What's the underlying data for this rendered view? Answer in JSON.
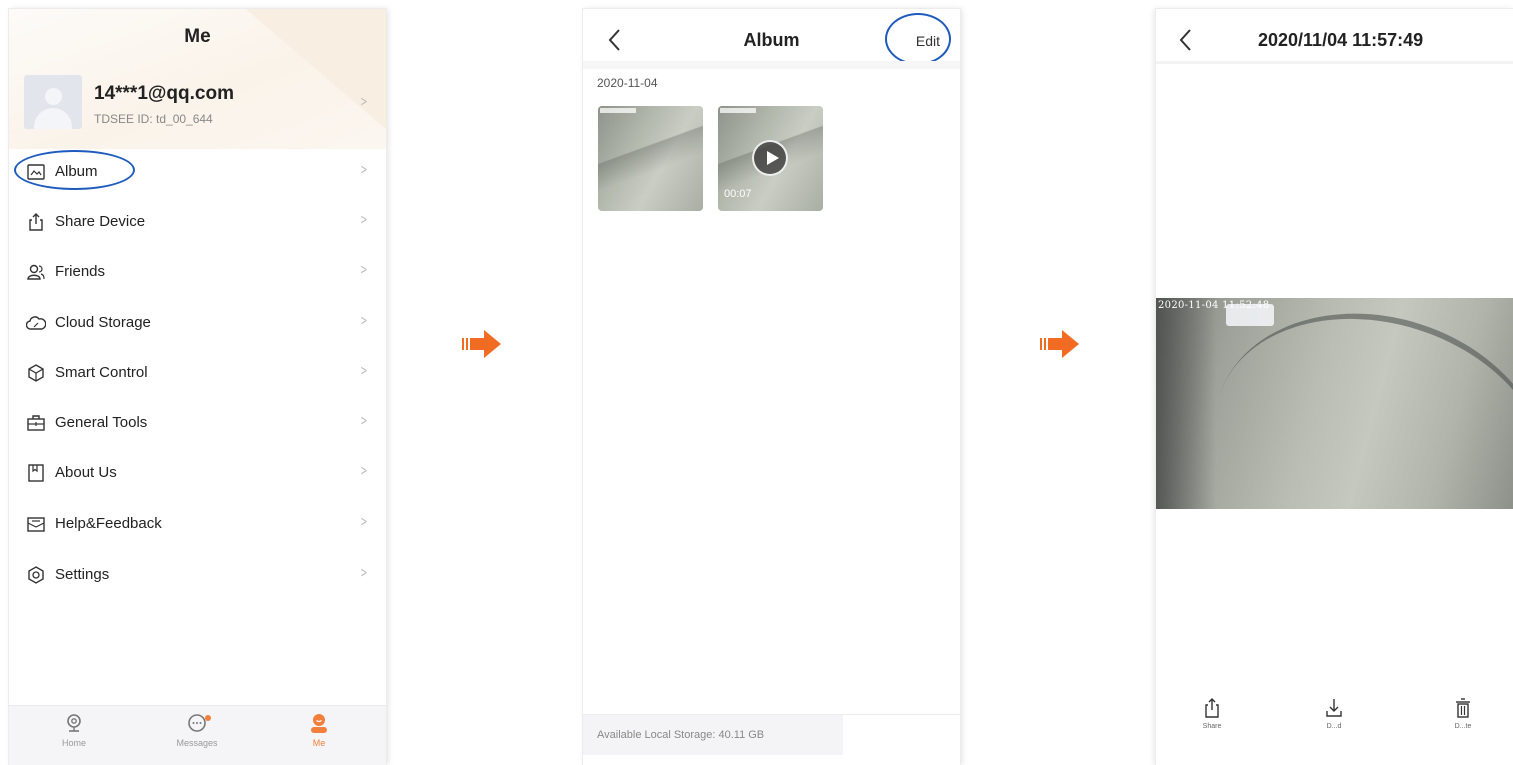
{
  "screen1": {
    "title": "Me",
    "profile": {
      "email": "14***1@qq.com",
      "id_text": "TDSEE ID: td_00_644"
    },
    "menu": [
      {
        "label": "Album",
        "icon": "image-icon"
      },
      {
        "label": "Share Device",
        "icon": "share-icon"
      },
      {
        "label": "Friends",
        "icon": "friends-icon"
      },
      {
        "label": "Cloud Storage",
        "icon": "cloud-icon"
      },
      {
        "label": "Smart Control",
        "icon": "cube-icon"
      },
      {
        "label": "General Tools",
        "icon": "toolbox-icon"
      },
      {
        "label": "About Us",
        "icon": "bookmark-icon"
      },
      {
        "label": "Help&Feedback",
        "icon": "mail-icon"
      },
      {
        "label": "Settings",
        "icon": "gear-icon"
      }
    ],
    "chevron": ">",
    "tabs": [
      {
        "label": "Home",
        "icon": "camera-icon"
      },
      {
        "label": "Messages",
        "icon": "chat-icon"
      },
      {
        "label": "Me",
        "icon": "person-icon",
        "active": true
      }
    ]
  },
  "screen2": {
    "title": "Album",
    "edit_label": "Edit",
    "date": "2020-11-04",
    "video_duration": "00:07",
    "storage_text": "Available Local Storage: 40.11 GB"
  },
  "screen3": {
    "title": "2020/11/04 11:57:49",
    "osd_timestamp": "2020-11-04 11:52:48",
    "actions": [
      {
        "label": "Share",
        "icon": "share-icon"
      },
      {
        "label": "D...d",
        "icon": "download-icon"
      },
      {
        "label": "D...te",
        "icon": "trash-icon"
      }
    ]
  },
  "colors": {
    "accent": "#f0803c",
    "highlight": "#1e5bbd",
    "arrow": "#f26b22"
  }
}
